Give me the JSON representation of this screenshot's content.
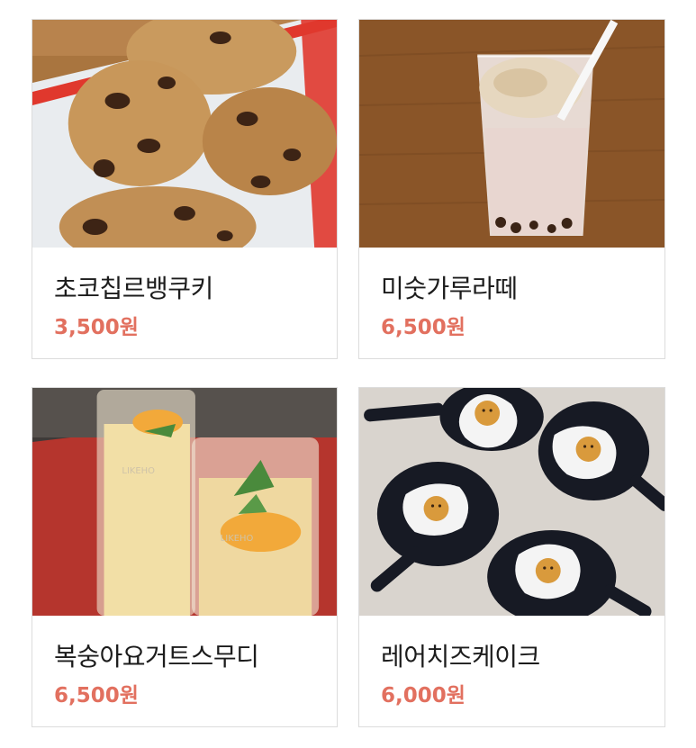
{
  "products": [
    {
      "name": "초코칩르뱅쿠키",
      "price": "3,500원"
    },
    {
      "name": "미숫가루라떼",
      "price": "6,500원"
    },
    {
      "name": "복숭아요거트스무디",
      "price": "6,500원"
    },
    {
      "name": "레어치즈케이크",
      "price": "6,000원"
    }
  ],
  "colors": {
    "price": "#e2705f",
    "name": "#1c1c1c",
    "border": "#dcdcdc"
  }
}
